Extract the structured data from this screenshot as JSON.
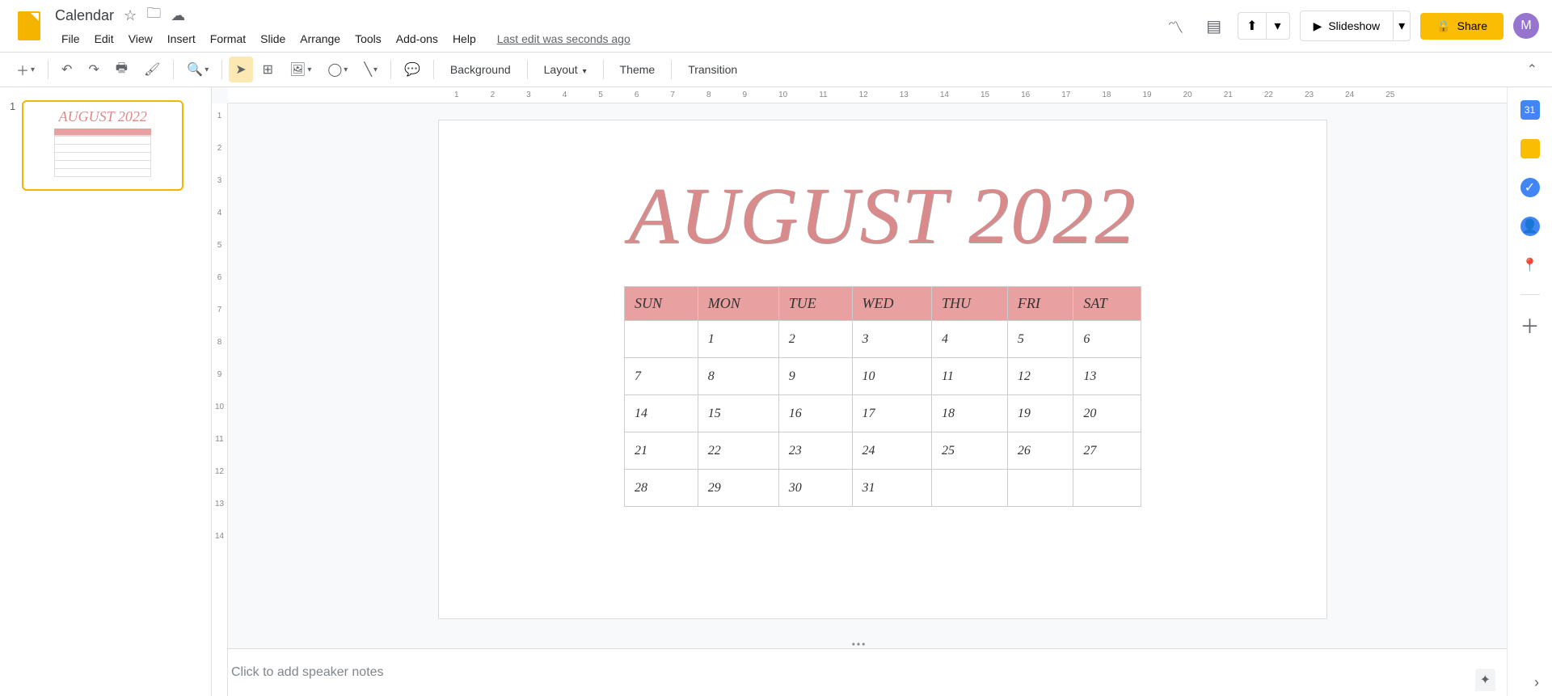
{
  "doc_title": "Calendar",
  "last_edit": "Last edit was seconds ago",
  "menus": [
    "File",
    "Edit",
    "View",
    "Insert",
    "Format",
    "Slide",
    "Arrange",
    "Tools",
    "Add-ons",
    "Help"
  ],
  "header_buttons": {
    "slideshow": "Slideshow",
    "share": "Share"
  },
  "avatar_letter": "M",
  "toolbar_text": {
    "background": "Background",
    "layout": "Layout",
    "theme": "Theme",
    "transition": "Transition"
  },
  "ruler_h": [
    "1",
    "2",
    "3",
    "4",
    "5",
    "6",
    "7",
    "8",
    "9",
    "10",
    "11",
    "12",
    "13",
    "14",
    "15",
    "16",
    "17",
    "18",
    "19",
    "20",
    "21",
    "22",
    "23",
    "24",
    "25"
  ],
  "ruler_v": [
    "1",
    "2",
    "3",
    "4",
    "5",
    "6",
    "7",
    "8",
    "9",
    "10",
    "11",
    "12",
    "13",
    "14"
  ],
  "thumb_number": "1",
  "thumb_title": "AUGUST 2022",
  "slide": {
    "title": "AUGUST 2022",
    "day_headers": [
      "SUN",
      "MON",
      "TUE",
      "WED",
      "THU",
      "FRI",
      "SAT"
    ],
    "weeks": [
      [
        "",
        "1",
        "2",
        "3",
        "4",
        "5",
        "6"
      ],
      [
        "7",
        "8",
        "9",
        "10",
        "11",
        "12",
        "13"
      ],
      [
        "14",
        "15",
        "16",
        "17",
        "18",
        "19",
        "20"
      ],
      [
        "21",
        "22",
        "23",
        "24",
        "25",
        "26",
        "27"
      ],
      [
        "28",
        "29",
        "30",
        "31",
        "",
        "",
        ""
      ]
    ]
  },
  "notes_placeholder": "Click to add speaker notes"
}
